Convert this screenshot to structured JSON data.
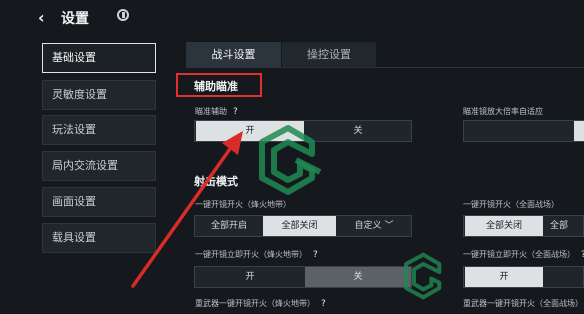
{
  "header": {
    "back_icon": "‹",
    "title": "设置",
    "icon": "eye-icon"
  },
  "sidebar": {
    "items": [
      {
        "label": "基础设置",
        "active": true
      },
      {
        "label": "灵敏度设置",
        "active": false
      },
      {
        "label": "玩法设置",
        "active": false
      },
      {
        "label": "局内交流设置",
        "active": false
      },
      {
        "label": "画面设置",
        "active": false
      },
      {
        "label": "载具设置",
        "active": false
      }
    ]
  },
  "tabs": [
    {
      "label": "战斗设置",
      "active": true
    },
    {
      "label": "操控设置",
      "active": false
    }
  ],
  "aim_assist": {
    "section_title": "辅助瞄准",
    "label": "瞄准辅助",
    "help": "?",
    "on": "开",
    "off": "关",
    "right_label": "瞄准镜放大倍率自适应"
  },
  "fire_mode": {
    "section_title": "射击模式",
    "scope_fire": {
      "label": "一键开镜开火（烽火地带）",
      "opt1": "全部开启",
      "opt2": "全部关闭",
      "opt3": "自定义",
      "selected": "全部关闭"
    },
    "scope_fire_right": {
      "label": "一键开镜开火（全面战场）",
      "opt1": "全部关闭",
      "opt2": "全部"
    },
    "instant_fire": {
      "label": "一键开镜立即开火（烽火地带）",
      "help": "?",
      "on": "开",
      "off": "关"
    },
    "instant_fire_right": {
      "label": "一键开镜立即开火（全面战场）",
      "help": "?",
      "on": "开"
    },
    "heavy_fire": {
      "label": "重武器一键开镜开火（烽火地带）",
      "help": "?"
    },
    "heavy_fire_right": {
      "label": "重武器一键开镜开火（全面战场）",
      "help": "?"
    }
  },
  "colors": {
    "highlight": "#e2302f",
    "arrow": "#d92b2a",
    "watermark": "#1f8a52"
  }
}
